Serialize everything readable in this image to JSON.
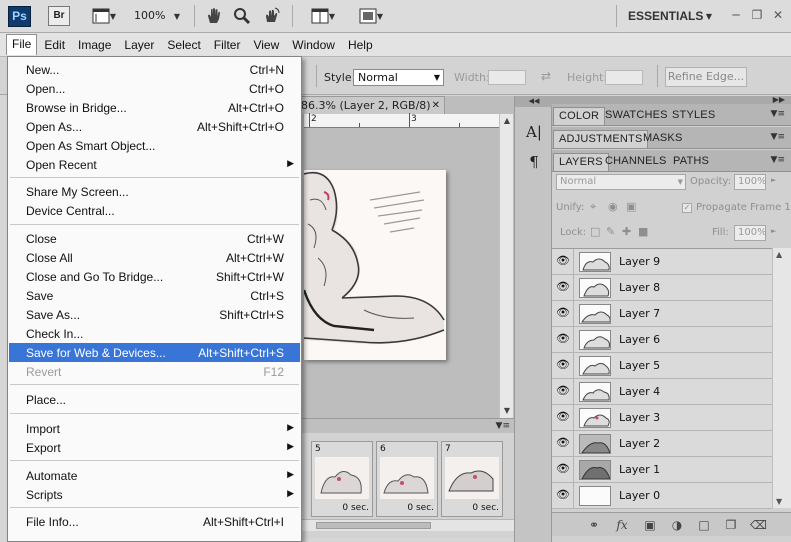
{
  "app": {
    "logo": "Ps",
    "bridge_logo": "Br",
    "zoom": "100%",
    "workspace": "ESSENTIALS",
    "icons": [
      "view-extras-icon",
      "hand-tool-icon",
      "zoom-tool-icon",
      "rotate-view-icon",
      "arrange-documents-icon",
      "screen-mode-icon",
      "minimize-icon",
      "restore-icon",
      "close-icon"
    ]
  },
  "menubar": [
    "File",
    "Edit",
    "Image",
    "Layer",
    "Select",
    "Filter",
    "View",
    "Window",
    "Help"
  ],
  "options": {
    "style_label": "Style:",
    "style_value": "Normal",
    "width_label": "Width:",
    "height_label": "Height:",
    "refine_edge": "Refine Edge..."
  },
  "document": {
    "tab_title": "86.3% (Layer 2, RGB/8)",
    "ruler_numbers": [
      "2",
      "3"
    ]
  },
  "file_menu": [
    {
      "label": "New...",
      "shortcut": "Ctrl+N"
    },
    {
      "label": "Open...",
      "shortcut": "Ctrl+O"
    },
    {
      "label": "Browse in Bridge...",
      "shortcut": "Alt+Ctrl+O"
    },
    {
      "label": "Open As...",
      "shortcut": "Alt+Shift+Ctrl+O"
    },
    {
      "label": "Open As Smart Object...",
      "shortcut": ""
    },
    {
      "label": "Open Recent",
      "shortcut": "",
      "submenu": true
    },
    {
      "separator": true
    },
    {
      "label": "Share My Screen...",
      "shortcut": ""
    },
    {
      "label": "Device Central...",
      "shortcut": ""
    },
    {
      "separator": true
    },
    {
      "label": "Close",
      "shortcut": "Ctrl+W"
    },
    {
      "label": "Close All",
      "shortcut": "Alt+Ctrl+W"
    },
    {
      "label": "Close and Go To Bridge...",
      "shortcut": "Shift+Ctrl+W"
    },
    {
      "label": "Save",
      "shortcut": "Ctrl+S"
    },
    {
      "label": "Save As...",
      "shortcut": "Shift+Ctrl+S"
    },
    {
      "label": "Check In...",
      "shortcut": ""
    },
    {
      "label": "Save for Web & Devices...",
      "shortcut": "Alt+Shift+Ctrl+S",
      "highlighted": true
    },
    {
      "label": "Revert",
      "shortcut": "F12",
      "disabled": true
    },
    {
      "separator": true
    },
    {
      "label": "Place...",
      "shortcut": ""
    },
    {
      "separator": true
    },
    {
      "label": "Import",
      "shortcut": "",
      "submenu": true
    },
    {
      "label": "Export",
      "shortcut": "",
      "submenu": true
    },
    {
      "separator": true
    },
    {
      "label": "Automate",
      "shortcut": "",
      "submenu": true
    },
    {
      "label": "Scripts",
      "shortcut": "",
      "submenu": true
    },
    {
      "separator": true
    },
    {
      "label": "File Info...",
      "shortcut": "Alt+Shift+Ctrl+I"
    }
  ],
  "animation": {
    "frames": [
      {
        "num": "5",
        "duration": "0 sec."
      },
      {
        "num": "6",
        "duration": "0 sec."
      },
      {
        "num": "7",
        "duration": "0 sec."
      }
    ]
  },
  "panels": {
    "tabs_row1": [
      "COLOR",
      "SWATCHES",
      "STYLES"
    ],
    "tabs_row2": [
      "ADJUSTMENTS",
      "MASKS"
    ],
    "tabs_row3": [
      "LAYERS",
      "CHANNELS",
      "PATHS"
    ],
    "blend_mode": "Normal",
    "opacity_label": "Opacity:",
    "opacity_value": "100%",
    "unify_label": "Unify:",
    "propagate_label": "Propagate Frame 1",
    "lock_label": "Lock:",
    "fill_label": "Fill:",
    "fill_value": "100%",
    "layers": [
      "Layer 9",
      "Layer 8",
      "Layer 7",
      "Layer 6",
      "Layer 5",
      "Layer 4",
      "Layer 3",
      "Layer 2",
      "Layer 1",
      "Layer 0"
    ],
    "selected_layer": "Layer 2",
    "footer_icons": [
      "link-layers-icon",
      "layer-style-icon",
      "add-mask-icon",
      "adjustment-layer-icon",
      "new-group-icon",
      "new-layer-icon",
      "delete-layer-icon"
    ]
  }
}
